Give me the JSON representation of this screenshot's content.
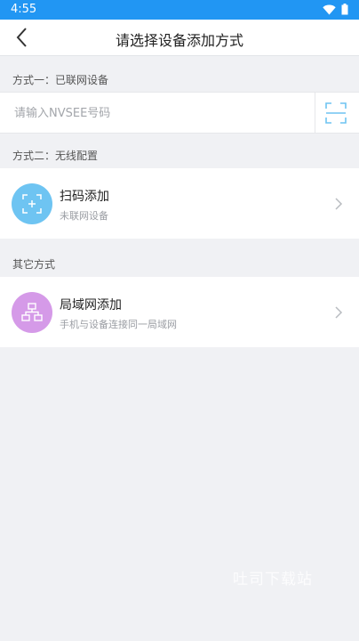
{
  "status_bar": {
    "time": "4:55"
  },
  "header": {
    "title": "请选择设备添加方式"
  },
  "section1": {
    "title": "方式一：已联网设备",
    "input_placeholder": "请输入NVSEE号码"
  },
  "section2": {
    "title": "方式二：无线配置",
    "option": {
      "title": "扫码添加",
      "subtitle": "未联网设备"
    }
  },
  "section3": {
    "title": "其它方式",
    "option": {
      "title": "局域网添加",
      "subtitle": "手机与设备连接同一局域网"
    }
  },
  "watermark": "吐司下载站",
  "colors": {
    "accent": "#2196f3",
    "scan_icon": "#6ec4f2",
    "scan_circle": "#6ec4f2",
    "lan_circle": "#d59ae8"
  }
}
